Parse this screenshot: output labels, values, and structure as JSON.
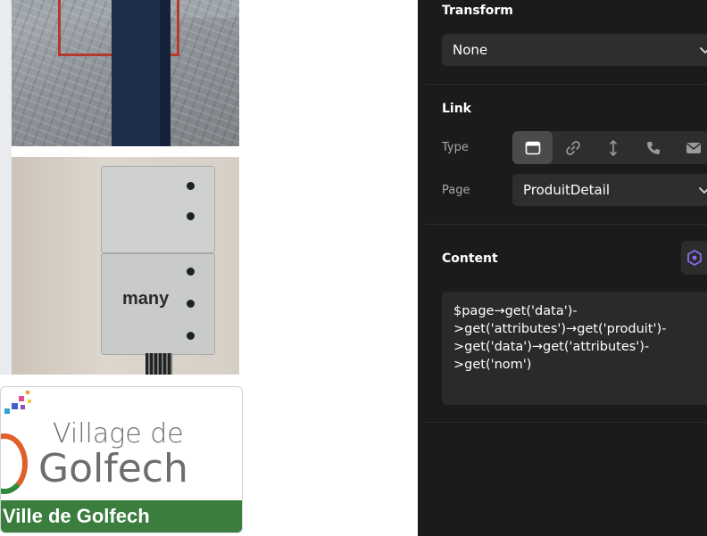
{
  "left_images": {
    "image1": {
      "alt": "parking bollard post"
    },
    "image2": {
      "brand": "many"
    },
    "image3": {
      "logo_line1": "Village de",
      "logo_line2": "Golfech",
      "band_text": "Ville de Golfech"
    }
  },
  "panel": {
    "transform": {
      "title": "Transform",
      "value": "None"
    },
    "link": {
      "title": "Link",
      "type_label": "Type",
      "type_buttons": [
        {
          "icon": "page-icon",
          "active": true
        },
        {
          "icon": "link-icon",
          "active": false
        },
        {
          "icon": "anchor-icon",
          "active": false
        },
        {
          "icon": "phone-icon",
          "active": false
        },
        {
          "icon": "mail-icon",
          "active": false
        }
      ],
      "page_label": "Page",
      "page_value": "ProduitDetail"
    },
    "content": {
      "title": "Content",
      "code": "$page→get('data')-\n>get('attributes')→get('produit')-\n>get('data')→get('attributes')-\n>get('nom')"
    },
    "colors": {
      "panel_bg": "#1b1b1b",
      "field_bg": "#2e2e2e",
      "accent": "#8b6cf0"
    }
  }
}
